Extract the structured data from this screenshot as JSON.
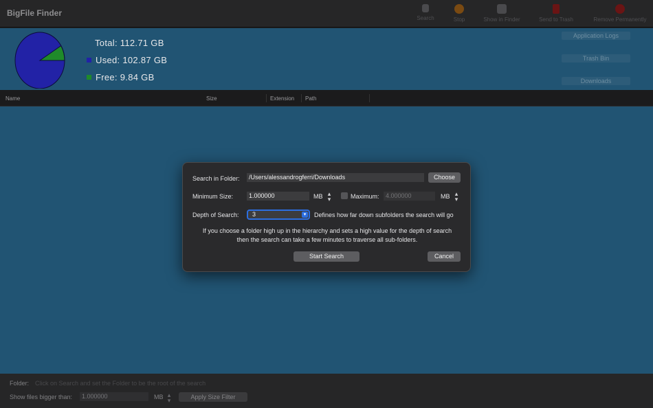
{
  "app": {
    "title": "BigFile Finder"
  },
  "toolbar": {
    "items": [
      {
        "label": "Search",
        "icon": "search-icon",
        "color": "#4a4a4d"
      },
      {
        "label": "Stop",
        "icon": "stop-icon",
        "color": "#7a4a12"
      },
      {
        "label": "Show in Finder",
        "icon": "finder-icon",
        "color": "#4a4a4d"
      },
      {
        "label": "Send to Trash",
        "icon": "trash-icon",
        "color": "#6a1414"
      },
      {
        "label": "Remove Permanently",
        "icon": "remove-icon",
        "color": "#6a1414"
      }
    ]
  },
  "summary": {
    "total": "Total: 112.71 GB",
    "used": "Used: 102.87 GB",
    "free": "Free: 9.84 GB",
    "used_fraction": 0.9127,
    "used_color": "#2222a6",
    "free_color": "#1f8a2a",
    "buttons": [
      "Application Logs",
      "Trash Bin",
      "Downloads"
    ]
  },
  "table": {
    "columns": [
      "Name",
      "Size",
      "Extension",
      "Path"
    ]
  },
  "dialog": {
    "folder_label": "Search in Folder:",
    "folder_value": "/Users/alessandrogferri/Downloads",
    "choose": "Choose",
    "min_label": "Minimum Size:",
    "min_value": "1.000000",
    "min_unit": "MB",
    "max_label": "Maximum:",
    "max_value": "4.000000",
    "max_unit": "MB",
    "depth_label": "Depth of Search:",
    "depth_value": "3",
    "depth_desc": "Defines how far down subfolders the search will go",
    "note_line1": "If you choose a folder high up in the hierarchy and sets a high value for the depth of search",
    "note_line2": "then the search can take a few minutes to traverse all sub-folders.",
    "start": "Start Search",
    "cancel": "Cancel"
  },
  "bottom": {
    "folder_label": "Folder:",
    "folder_hint": "Click on Search and set the Folder to be the root of the search",
    "bigger_label": "Show files bigger than:",
    "bigger_value": "1.000000",
    "unit": "MB",
    "apply": "Apply Size Filter"
  },
  "accent": "#2c6ee0",
  "panel_color": "#215473"
}
